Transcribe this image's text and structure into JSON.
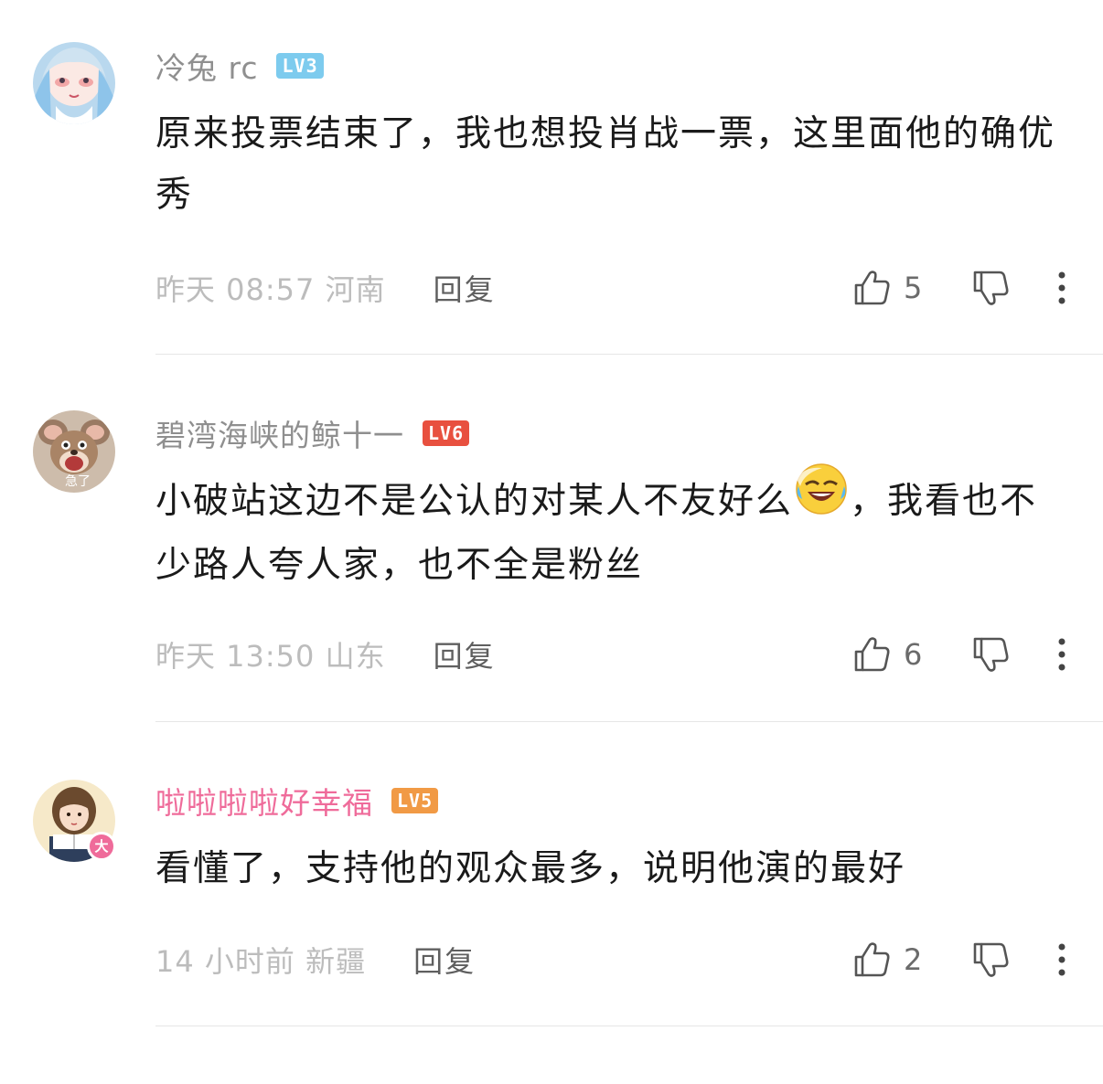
{
  "comments": [
    {
      "username": "冷兔 rc",
      "level": "LV3",
      "level_color": "#7dcbee",
      "content": "原来投票结束了，我也想投肖战一票，这里面他的确优秀",
      "timestamp": "昨天 08:57 河南",
      "reply_label": "回复",
      "likes": "5",
      "avatar_icon": "anime-girl-avatar"
    },
    {
      "username": "碧湾海峡的鲸十一",
      "level": "LV6",
      "level_color": "#e8503f",
      "content_before": "小破站这边不是公认的对某人不友好么",
      "content_emoji": "laughing-tears-emoji",
      "content_after": "，我看也不少路人夸人家，也不全是粉丝",
      "timestamp": "昨天 13:50 山东",
      "reply_label": "回复",
      "likes": "6",
      "avatar_icon": "cartoon-mouse-avatar",
      "avatar_caption": "急了"
    },
    {
      "username": "啦啦啦啦好幸福",
      "username_color": "#ef6b9a",
      "level": "LV5",
      "level_color": "#f19a45",
      "content": "看懂了，支持他的观众最多，说明他演的最好",
      "timestamp": "14 小时前 新疆",
      "reply_label": "回复",
      "likes": "2",
      "avatar_icon": "girl-reading-avatar",
      "avatar_badge": "大"
    }
  ]
}
